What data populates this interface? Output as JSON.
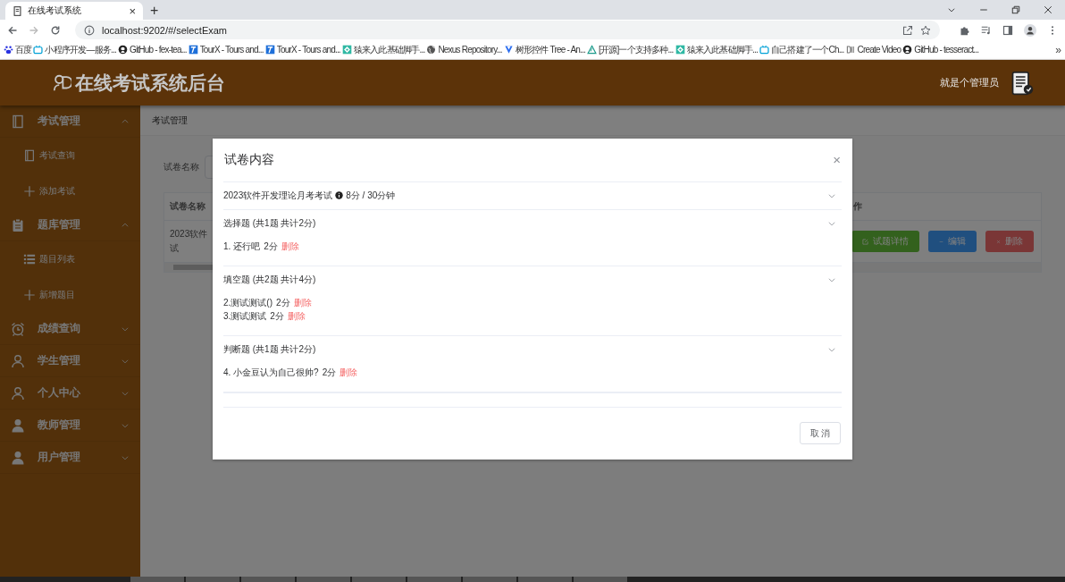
{
  "browser": {
    "tab": {
      "title": "在线考试系统",
      "close": "×"
    },
    "new_tab": "+",
    "address": "localhost:9202/#/selectExam",
    "bookmarks": [
      {
        "kind": "paw",
        "label": "百度"
      },
      {
        "kind": "tv",
        "label": "小程序开发—服务..."
      },
      {
        "kind": "github",
        "label": "GitHub - fex-tea..."
      },
      {
        "kind": "tourx",
        "label": "TourX - Tours and..."
      },
      {
        "kind": "tourx",
        "label": "TourX - Tours and..."
      },
      {
        "kind": "diamond",
        "label": "猿来入此基础脚手..."
      },
      {
        "kind": "globe",
        "label": "Nexus Repository..."
      },
      {
        "kind": "vue",
        "label": "树形控件 Tree - An..."
      },
      {
        "kind": "triangle",
        "label": "[开源]一个支持多种..."
      },
      {
        "kind": "diamond",
        "label": "猿来入此基础脚手..."
      },
      {
        "kind": "tv",
        "label": "自己搭建了一个Ch..."
      },
      {
        "kind": "di",
        "label": "Create Video"
      },
      {
        "kind": "github",
        "label": "GitHub - tesseract..."
      }
    ],
    "more": "»"
  },
  "header": {
    "title": "在线考试系统后台",
    "user": "就是个管理员"
  },
  "sidebar": [
    {
      "kind": "book",
      "label": "考试管理",
      "expanded": true,
      "children": [
        {
          "kind": "book",
          "label": "考试查询"
        },
        {
          "kind": "plus",
          "label": "添加考试"
        }
      ]
    },
    {
      "kind": "clipboard",
      "label": "题库管理",
      "expanded": true,
      "children": [
        {
          "kind": "list",
          "label": "题目列表"
        },
        {
          "kind": "plus",
          "label": "新增题目"
        }
      ]
    },
    {
      "kind": "alarm",
      "label": "成绩查询",
      "expanded": false
    },
    {
      "kind": "person",
      "label": "学生管理",
      "expanded": false
    },
    {
      "kind": "person",
      "label": "个人中心",
      "expanded": false
    },
    {
      "kind": "person-filled",
      "label": "教师管理",
      "expanded": false
    },
    {
      "kind": "person-filled",
      "label": "用户管理",
      "expanded": false
    }
  ],
  "breadcrumb": "考试管理",
  "search": {
    "label": "试卷名称"
  },
  "table": {
    "columns": [
      "试卷名称",
      "作"
    ],
    "rows": [
      {
        "name_lines": [
          "2023软件",
          "试"
        ],
        "buttons": [
          {
            "kind": "success",
            "label": "试题详情"
          },
          {
            "kind": "primary",
            "label": "编辑"
          },
          {
            "kind": "danger",
            "label": "删除"
          }
        ]
      }
    ]
  },
  "dialog": {
    "title": "试卷内容",
    "close": "×",
    "sections": [
      {
        "title": "2023软件开发理论月考考试",
        "info": true,
        "meta": "8分 / 30分钟"
      },
      {
        "title": "选择题 (共1题 共计2分)",
        "info": false,
        "questions": [
          {
            "text": "1. 还行吧",
            "score": "2分",
            "action": "删除"
          }
        ]
      },
      {
        "title": "填空题 (共2题 共计4分)",
        "info": false,
        "questions": [
          {
            "text": "2.测试测试()",
            "score": "2分",
            "action": "删除"
          },
          {
            "text": "3.测试测试",
            "score": "2分",
            "action": "删除"
          }
        ]
      },
      {
        "title": "判断题 (共1题 共计2分)",
        "info": false,
        "questions": [
          {
            "text": "4. 小金豆认为自己很帅?",
            "score": "2分",
            "action": "删除"
          }
        ]
      }
    ],
    "cancel": "取 消"
  }
}
